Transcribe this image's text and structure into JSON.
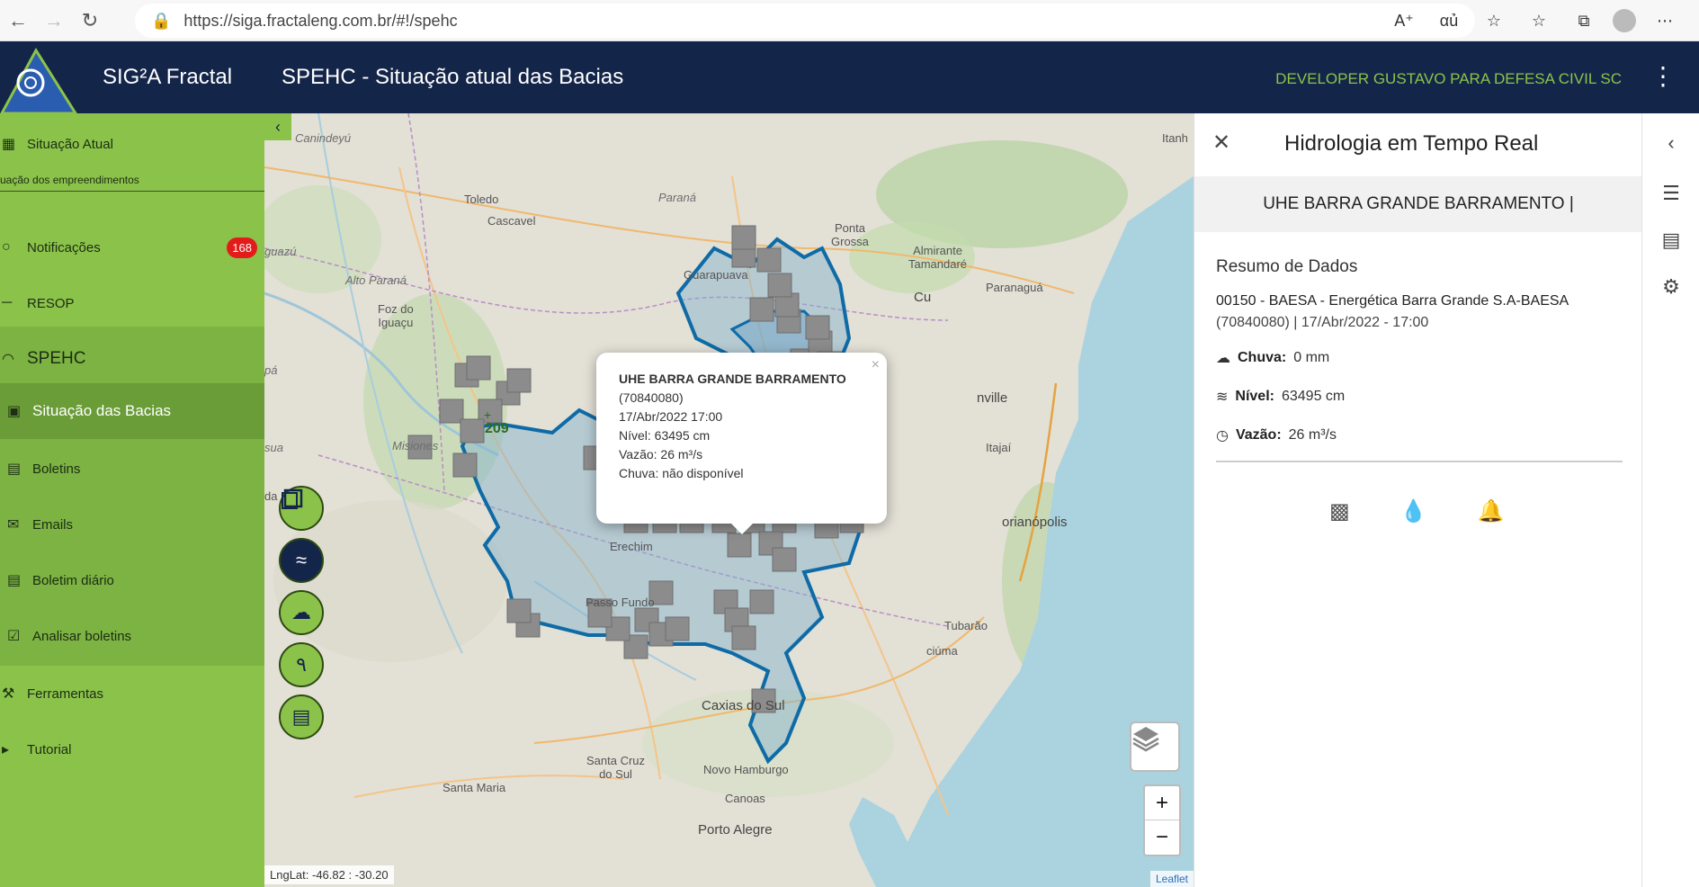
{
  "browser": {
    "url": "https://siga.fractaleng.com.br/#!/spehc"
  },
  "header": {
    "app_name": "SIG²A Fractal",
    "page_title": "SPEHC - Situação atual das Bacias",
    "user": "DEVELOPER GUSTAVO PARA DEFESA CIVIL SC"
  },
  "sidebar": {
    "situacao_atual": "Situação Atual",
    "situacao_empreendimentos": "uação dos empreendimentos",
    "notificacoes": "Notificações",
    "notificacoes_badge": "168",
    "resop": "RESOP",
    "spehc": "SPEHC",
    "situacao_bacias": "Situação das Bacias",
    "boletins": "Boletins",
    "emails": "Emails",
    "boletim_diario": "Boletim diário",
    "analisar_boletins": "Analisar boletins",
    "ferramentas": "Ferramentas",
    "tutorial": "Tutorial"
  },
  "map": {
    "labels": {
      "canindeyu": "Canindeyú",
      "toledo": "Toledo",
      "parana": "Paraná",
      "cascavel": "Cascavel",
      "ponta_grossa": "Ponta\nGrossa",
      "almirante": "Almirante\nTamandaré",
      "curitiba": "Cu",
      "paranagua": "Paranaguá",
      "guarapuava": "Guarapuava",
      "alto_parana": "Alto Paraná",
      "foz": "Foz do\nIguaçu",
      "misiones": "Misiones",
      "itanh": "Itanh",
      "joinville": "nville",
      "itajai": "Itajaí",
      "florianopolis": "orianópolis",
      "erechim": "Erechim",
      "passo_fundo": "Passo Fundo",
      "tubarao": "Tubarão",
      "criciuma": "ciúma",
      "caxias": "Caxias do Sul",
      "santa_cruz": "Santa Cruz\ndo Sul",
      "novo_hamburgo": "Novo Hamburgo",
      "canoas": "Canoas",
      "santa_maria": "Santa Maria",
      "porto_alegre": "Porto Alegre",
      "guazu": "guazú",
      "pa": "pá",
      "sua": "sua",
      "da": "da",
      "cluster": "209"
    },
    "coords": "LngLat: -46.82 : -30.20",
    "attribution": "Leaflet",
    "popup": {
      "title": "UHE BARRA GRANDE BARRAMENTO",
      "code": "(70840080)",
      "datetime": "17/Abr/2022 17:00",
      "nivel": "Nível: 63495 cm",
      "vazao": "Vazão: 26 m³/s",
      "chuva": "Chuva: não disponível"
    }
  },
  "panel": {
    "title": "Hidrologia em Tempo Real",
    "station": "UHE BARRA GRANDE BARRAMENTO |",
    "summary_title": "Resumo de Dados",
    "station_name": "00150 - BAESA - Energética Barra Grande S.A-BAESA",
    "station_meta": "(70840080) | 17/Abr/2022 - 17:00",
    "chuva_label": "Chuva:",
    "chuva_value": "0 mm",
    "nivel_label": "Nível:",
    "nivel_value": "63495 cm",
    "vazao_label": "Vazão:",
    "vazao_value": "26 m³/s"
  },
  "colors": {
    "header": "#14254a",
    "sidebar": "#8bc34a",
    "user_text": "#8bc34a",
    "basin_outline": "#1a6fa8",
    "station_marker": "#8c8c8c"
  }
}
